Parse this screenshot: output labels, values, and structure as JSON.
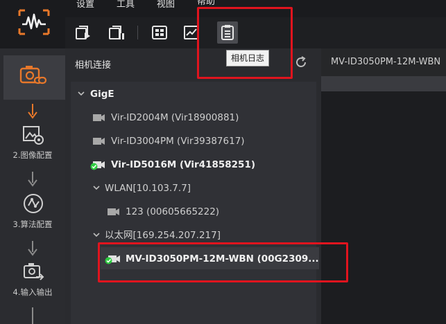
{
  "menu": {
    "items": [
      {
        "label": "设置"
      },
      {
        "label": "工具"
      },
      {
        "label": "视图"
      },
      {
        "label": "帮助"
      }
    ]
  },
  "toolbar": {
    "tooltip": "相机日志",
    "buttons": [
      {
        "icon": "camera-play-icon"
      },
      {
        "icon": "camera-stop-icon"
      },
      {
        "icon": "grid-view-icon"
      },
      {
        "icon": "chart-icon"
      },
      {
        "icon": "log-icon"
      }
    ]
  },
  "rail": {
    "steps": [
      {
        "label": "",
        "icon": "camera-link-icon",
        "active": true
      },
      {
        "label": "2.图像配置",
        "icon": "image-config-icon"
      },
      {
        "label": "3.算法配置",
        "icon": "algorithm-icon"
      },
      {
        "label": "4.输入输出",
        "icon": "io-icon"
      }
    ]
  },
  "panel": {
    "title": "相机连接",
    "tree": {
      "gige": {
        "label": "GigE",
        "devices": [
          {
            "label": "Vir-ID2004M (Vir18900881)",
            "connected": false
          },
          {
            "label": "Vir-ID3004PM (Vir39387617)",
            "connected": false
          },
          {
            "label": "Vir-ID5016M (Vir41858251)",
            "connected": true
          }
        ],
        "wlan": {
          "label": "WLAN[10.103.7.7]",
          "devices": [
            {
              "label": "123 (00605665222)",
              "connected": false
            }
          ]
        },
        "ethernet": {
          "label": "以太网[169.254.207.217]",
          "devices": [
            {
              "label": "MV-ID3050PM-12M-WBN (00G2309...",
              "connected": true,
              "selected": true
            }
          ]
        }
      }
    }
  },
  "right": {
    "tab_label": "MV-ID3050PM-12M-WBN"
  },
  "colors": {
    "highlight": "#e0141e",
    "accent": "#e8782a",
    "connected": "#2ecc40"
  }
}
